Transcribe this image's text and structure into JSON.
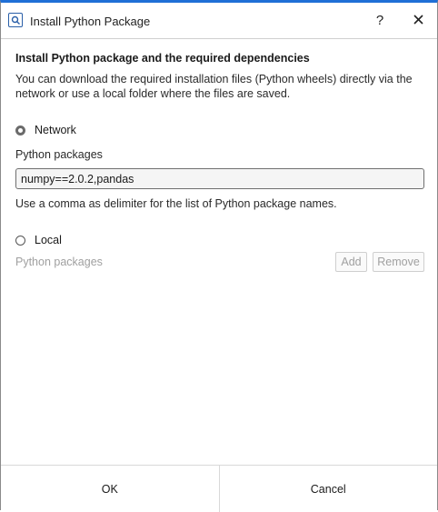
{
  "window": {
    "title": "Install Python Package",
    "help_glyph": "?",
    "app_icon": "search-icon",
    "close_icon": "close-icon"
  },
  "content": {
    "heading": "Install Python package and the required dependencies",
    "description": "You can download the required installation files (Python wheels) directly via the network or use a local folder where the files are saved."
  },
  "network": {
    "label": "Network",
    "selected": true,
    "packages_label": "Python packages",
    "packages_value": "numpy==2.0.2,pandas",
    "hint": "Use a comma as delimiter for the list of Python package names."
  },
  "local": {
    "label": "Local",
    "selected": false,
    "packages_label": "Python packages",
    "add_label": "Add",
    "remove_label": "Remove"
  },
  "footer": {
    "ok_label": "OK",
    "cancel_label": "Cancel"
  },
  "colors": {
    "accent": "#1f6fd6",
    "disabled_text": "#a0a0a0"
  }
}
